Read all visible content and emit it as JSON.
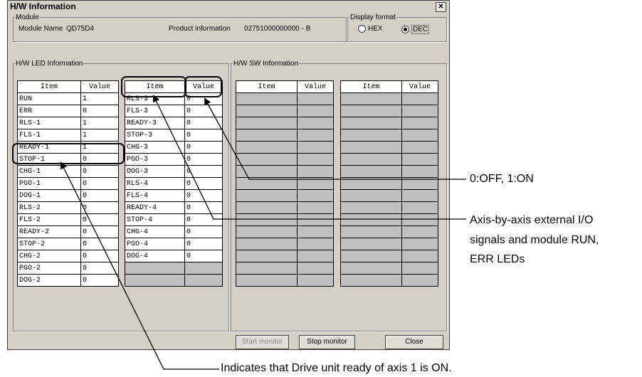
{
  "window": {
    "title": "H/W Information",
    "close_glyph": "✕"
  },
  "module": {
    "group_label": "Module",
    "name_label": "Module Name",
    "name_value": "QD75D4",
    "product_label": "Product information",
    "product_value": "02751000000000 - B"
  },
  "display_format": {
    "group_label": "Display format",
    "hex": "HEX",
    "dec": "DEC",
    "selected": "DEC"
  },
  "led": {
    "group_label": "H/W LED Information",
    "headers": {
      "item": "Item",
      "value": "Value"
    },
    "left_rows": [
      {
        "item": "RUN",
        "value": "1"
      },
      {
        "item": "ERR",
        "value": "0"
      },
      {
        "item": "RLS-1",
        "value": "1"
      },
      {
        "item": "FLS-1",
        "value": "1"
      },
      {
        "item": "READY-1",
        "value": "1"
      },
      {
        "item": "STOP-1",
        "value": "0"
      },
      {
        "item": "CHG-1",
        "value": "0"
      },
      {
        "item": "PGO-1",
        "value": "0"
      },
      {
        "item": "DOG-1",
        "value": "0"
      },
      {
        "item": "RLS-2",
        "value": "0"
      },
      {
        "item": "FLS-2",
        "value": "0"
      },
      {
        "item": "READY-2",
        "value": "0"
      },
      {
        "item": "STOP-2",
        "value": "0"
      },
      {
        "item": "CHG-2",
        "value": "0"
      },
      {
        "item": "PGO-2",
        "value": "0"
      },
      {
        "item": "DOG-2",
        "value": "0"
      }
    ],
    "right_rows": [
      {
        "item": "RLS-3",
        "value": "0"
      },
      {
        "item": "FLS-3",
        "value": "0"
      },
      {
        "item": "READY-3",
        "value": "0"
      },
      {
        "item": "STOP-3",
        "value": "0"
      },
      {
        "item": "CHG-3",
        "value": "0"
      },
      {
        "item": "PGO-3",
        "value": "0"
      },
      {
        "item": "DOG-3",
        "value": "0"
      },
      {
        "item": "RLS-4",
        "value": "0"
      },
      {
        "item": "FLS-4",
        "value": "0"
      },
      {
        "item": "READY-4",
        "value": "0"
      },
      {
        "item": "STOP-4",
        "value": "0"
      },
      {
        "item": "CHG-4",
        "value": "0"
      },
      {
        "item": "PGO-4",
        "value": "0"
      },
      {
        "item": "DOG-4",
        "value": "0"
      },
      {
        "item": "",
        "value": ""
      },
      {
        "item": "",
        "value": ""
      }
    ]
  },
  "sw": {
    "group_label": "H/W SW Information",
    "headers": {
      "item": "Item",
      "value": "Value"
    }
  },
  "buttons": {
    "start": "Start monitor",
    "stop": "Stop monitor",
    "close": "Close"
  },
  "annotations": {
    "on_off": "0:OFF, 1:ON",
    "axis_line1": "Axis-by-axis external I/O",
    "axis_line2": "signals and module RUN,",
    "axis_line3": "ERR LEDs",
    "ready": "Indicates that Drive unit ready of axis 1 is ON."
  }
}
